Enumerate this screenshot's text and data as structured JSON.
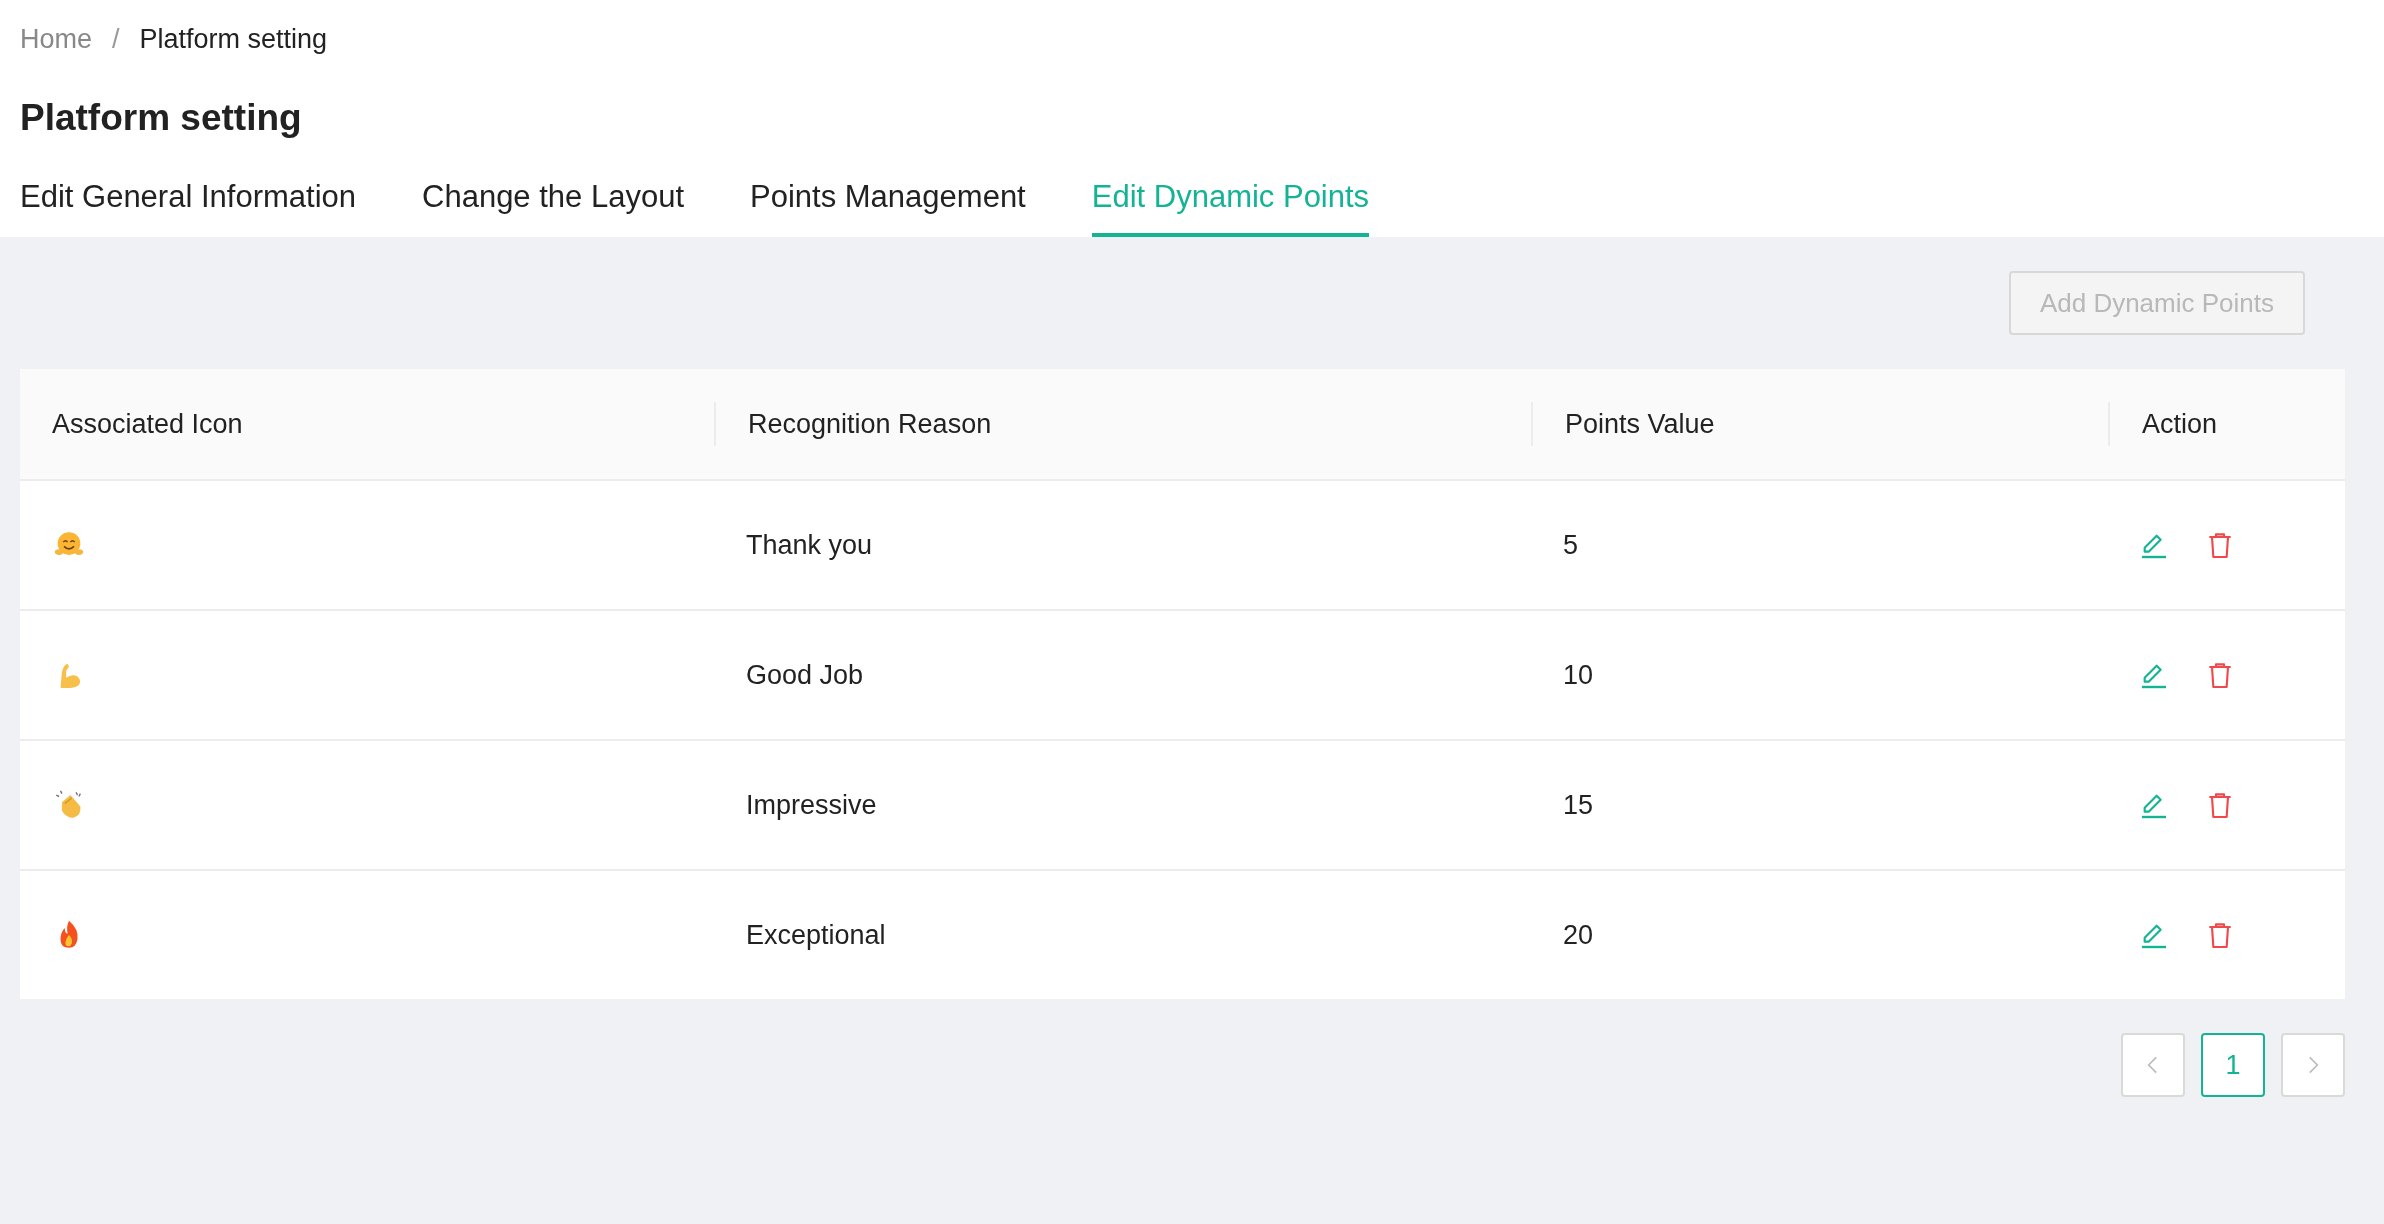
{
  "breadcrumb": [
    {
      "label": "Home",
      "current": false
    },
    {
      "label": "Platform setting",
      "current": true
    }
  ],
  "breadcrumb_separator": "/",
  "title": "Platform setting",
  "tabs": [
    {
      "label": "Edit General Information",
      "selected": false
    },
    {
      "label": "Change the Layout",
      "selected": false
    },
    {
      "label": "Points Management",
      "selected": false
    },
    {
      "label": "Edit Dynamic Points",
      "selected": true
    }
  ],
  "add_button": {
    "label": "Add Dynamic Points",
    "disabled": true
  },
  "table": {
    "columns": [
      "Associated Icon",
      "Recognition Reason",
      "Points Value",
      "Action"
    ],
    "rows": [
      {
        "kind": "hug",
        "reason": "Thank you",
        "points": "5"
      },
      {
        "kind": "muscle",
        "reason": "Good Job",
        "points": "10"
      },
      {
        "kind": "clap",
        "reason": "Impressive",
        "points": "15"
      },
      {
        "kind": "fire",
        "reason": "Exceptional",
        "points": "20"
      }
    ]
  },
  "pagination": {
    "prev_disabled": true,
    "next_disabled": true,
    "pages": [
      {
        "label": "1",
        "selected": true
      }
    ]
  }
}
